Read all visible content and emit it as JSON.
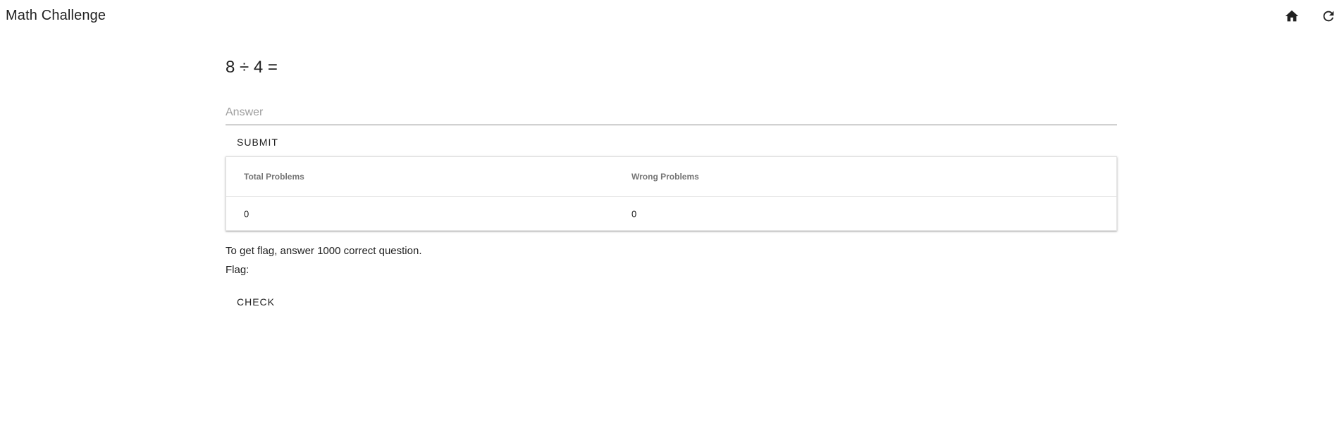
{
  "app": {
    "title": "Math Challenge",
    "icons": [
      "home-icon",
      "refresh-icon"
    ]
  },
  "problem": {
    "expression": "8 ÷ 4 ="
  },
  "answer": {
    "placeholder": "Answer",
    "value": ""
  },
  "buttons": {
    "submit_label": "SUBMIT",
    "check_label": "CHECK"
  },
  "stats": {
    "headers": [
      "Total Problems",
      "Wrong Problems"
    ],
    "values": [
      "0",
      "0"
    ]
  },
  "info": {
    "goal_text": "To get flag, answer 1000 correct question.",
    "flag_label": "Flag:",
    "flag_value": ""
  },
  "colors": {
    "text": "#212121",
    "header_text": "#757575",
    "underline": "#8a8a8a",
    "placeholder": "#9e9e9e"
  }
}
